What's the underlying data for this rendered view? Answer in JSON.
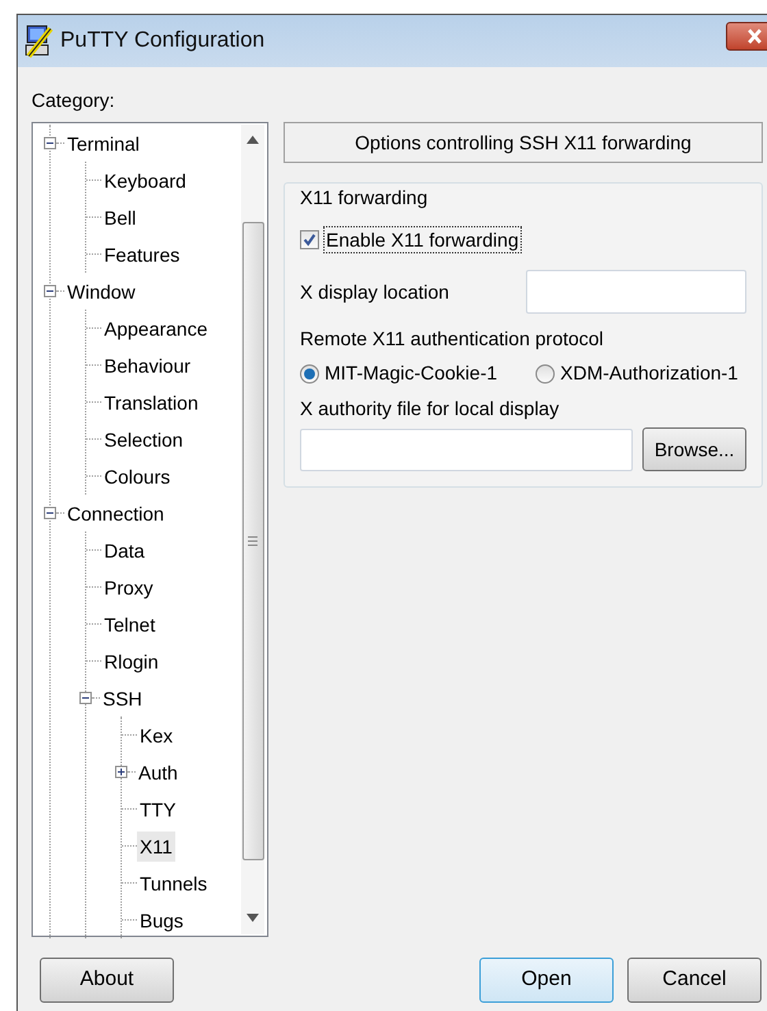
{
  "window": {
    "title": "PuTTY Configuration"
  },
  "category_label": "Category:",
  "tree": [
    {
      "label": "Terminal",
      "kind": "group",
      "expanded": true,
      "selected": false,
      "children": [
        {
          "label": "Keyboard",
          "kind": "leaf",
          "selected": false
        },
        {
          "label": "Bell",
          "kind": "leaf",
          "selected": false
        },
        {
          "label": "Features",
          "kind": "leaf",
          "selected": false
        }
      ]
    },
    {
      "label": "Window",
      "kind": "group",
      "expanded": true,
      "selected": false,
      "children": [
        {
          "label": "Appearance",
          "kind": "leaf",
          "selected": false
        },
        {
          "label": "Behaviour",
          "kind": "leaf",
          "selected": false
        },
        {
          "label": "Translation",
          "kind": "leaf",
          "selected": false
        },
        {
          "label": "Selection",
          "kind": "leaf",
          "selected": false
        },
        {
          "label": "Colours",
          "kind": "leaf",
          "selected": false
        }
      ]
    },
    {
      "label": "Connection",
      "kind": "group",
      "expanded": true,
      "selected": false,
      "children": [
        {
          "label": "Data",
          "kind": "leaf",
          "selected": false
        },
        {
          "label": "Proxy",
          "kind": "leaf",
          "selected": false
        },
        {
          "label": "Telnet",
          "kind": "leaf",
          "selected": false
        },
        {
          "label": "Rlogin",
          "kind": "leaf",
          "selected": false
        },
        {
          "label": "SSH",
          "kind": "group",
          "expanded": true,
          "selected": false,
          "children": [
            {
              "label": "Kex",
              "kind": "leaf",
              "selected": false
            },
            {
              "label": "Auth",
              "kind": "group",
              "expanded": false,
              "selected": false
            },
            {
              "label": "TTY",
              "kind": "leaf",
              "selected": false
            },
            {
              "label": "X11",
              "kind": "leaf",
              "selected": true
            },
            {
              "label": "Tunnels",
              "kind": "leaf",
              "selected": false
            },
            {
              "label": "Bugs",
              "kind": "leaf",
              "selected": false
            }
          ]
        }
      ]
    }
  ],
  "panel": {
    "header": "Options controlling SSH X11 forwarding",
    "group": {
      "title": "X11 forwarding",
      "enable": {
        "label": "Enable X11 forwarding",
        "checked": true,
        "focused": true
      },
      "display_location": {
        "label": "X display location"
      },
      "protocol_label": "Remote X11 authentication protocol",
      "protocols": [
        {
          "label": "MIT-Magic-Cookie-1",
          "selected": true
        },
        {
          "label": "XDM-Authorization-1",
          "selected": false
        }
      ],
      "authority_file": {
        "label": "X authority file for local display"
      },
      "browse_button": "Browse..."
    }
  },
  "buttons": [
    {
      "label": "About",
      "default": false
    },
    {
      "label": "Open",
      "default": true
    },
    {
      "label": "Cancel",
      "default": false
    }
  ]
}
